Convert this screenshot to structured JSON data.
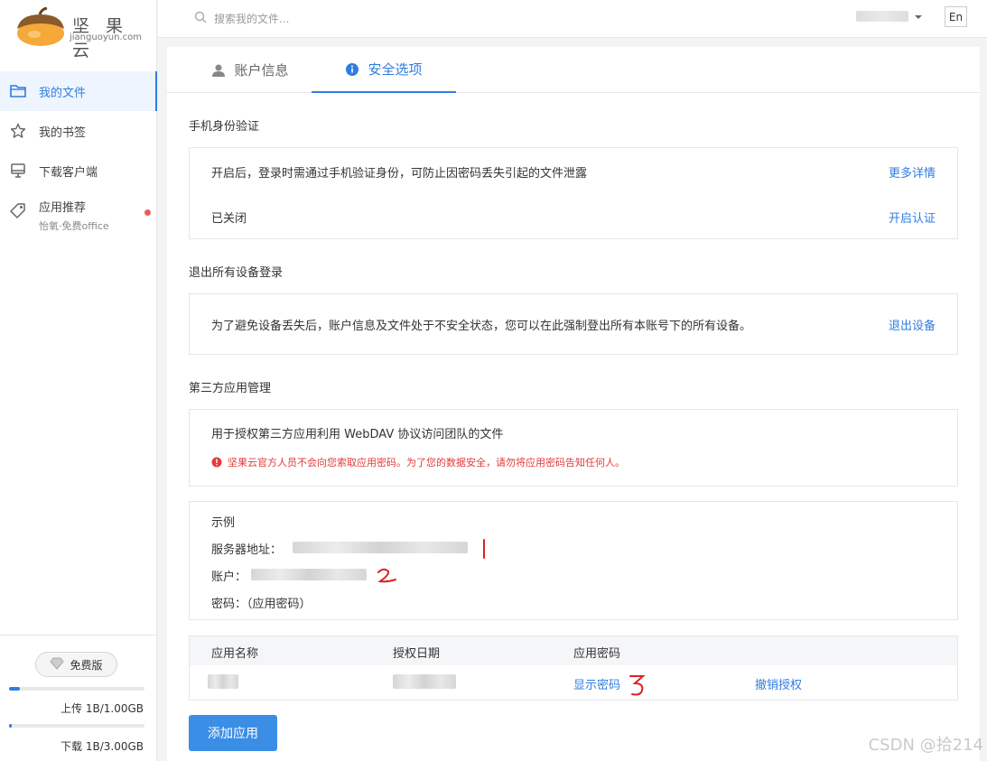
{
  "app": {
    "logo_name": "坚 果 云",
    "logo_domain": "jianguoyun.com"
  },
  "header": {
    "search_placeholder": "搜索我的文件...",
    "lang_button": "En"
  },
  "sidebar": {
    "items": [
      {
        "label": "我的文件",
        "icon": "folder-icon",
        "active": true
      },
      {
        "label": "我的书签",
        "icon": "star-icon"
      },
      {
        "label": "下载客户端",
        "icon": "monitor-icon"
      },
      {
        "label": "应用推荐",
        "sub": "怡氧·免费office",
        "icon": "tag-icon",
        "has_dot": true
      }
    ],
    "plan_label": "免费版",
    "upload_label": "上传 1B/1.00GB",
    "upload_fraction": 0.08,
    "download_label": "下载 1B/3.00GB",
    "download_fraction": 0.02
  },
  "tabs": [
    {
      "label": "账户信息",
      "icon": "user-icon",
      "active": false
    },
    {
      "label": "安全选项",
      "icon": "info-icon",
      "active": true
    }
  ],
  "phone_auth": {
    "title": "手机身份验证",
    "description": "开启后，登录时需通过手机验证身份，可防止因密码丢失引起的文件泄露",
    "more_link": "更多详情",
    "status": "已关闭",
    "enable_link": "开启认证"
  },
  "logout_all": {
    "title": "退出所有设备登录",
    "description": "为了避免设备丢失后，账户信息及文件处于不安全状态，您可以在此强制登出所有本账号下的所有设备。",
    "action_link": "退出设备"
  },
  "third_party": {
    "title": "第三方应用管理",
    "description": "用于授权第三方应用利用 WebDAV 协议访问团队的文件",
    "warning": "坚果云官方人员不会向您索取应用密码。为了您的数据安全，请勿将应用密码告知任何人。",
    "example": {
      "heading": "示例",
      "server_label": "服务器地址：",
      "account_label": "账户：",
      "password_label": "密码：",
      "password_value": "（应用密码）"
    },
    "table": {
      "headers": [
        "应用名称",
        "授权日期",
        "应用密码"
      ],
      "show_password_link": "显示密码",
      "revoke_link": "撤销授权"
    },
    "add_button": "添加应用"
  },
  "annotations": [
    "1",
    "2",
    "3"
  ],
  "watermark": "CSDN @拾214",
  "colors": {
    "accent": "#2f7de1",
    "warning": "#e23b3b",
    "annotation": "#e02020"
  }
}
